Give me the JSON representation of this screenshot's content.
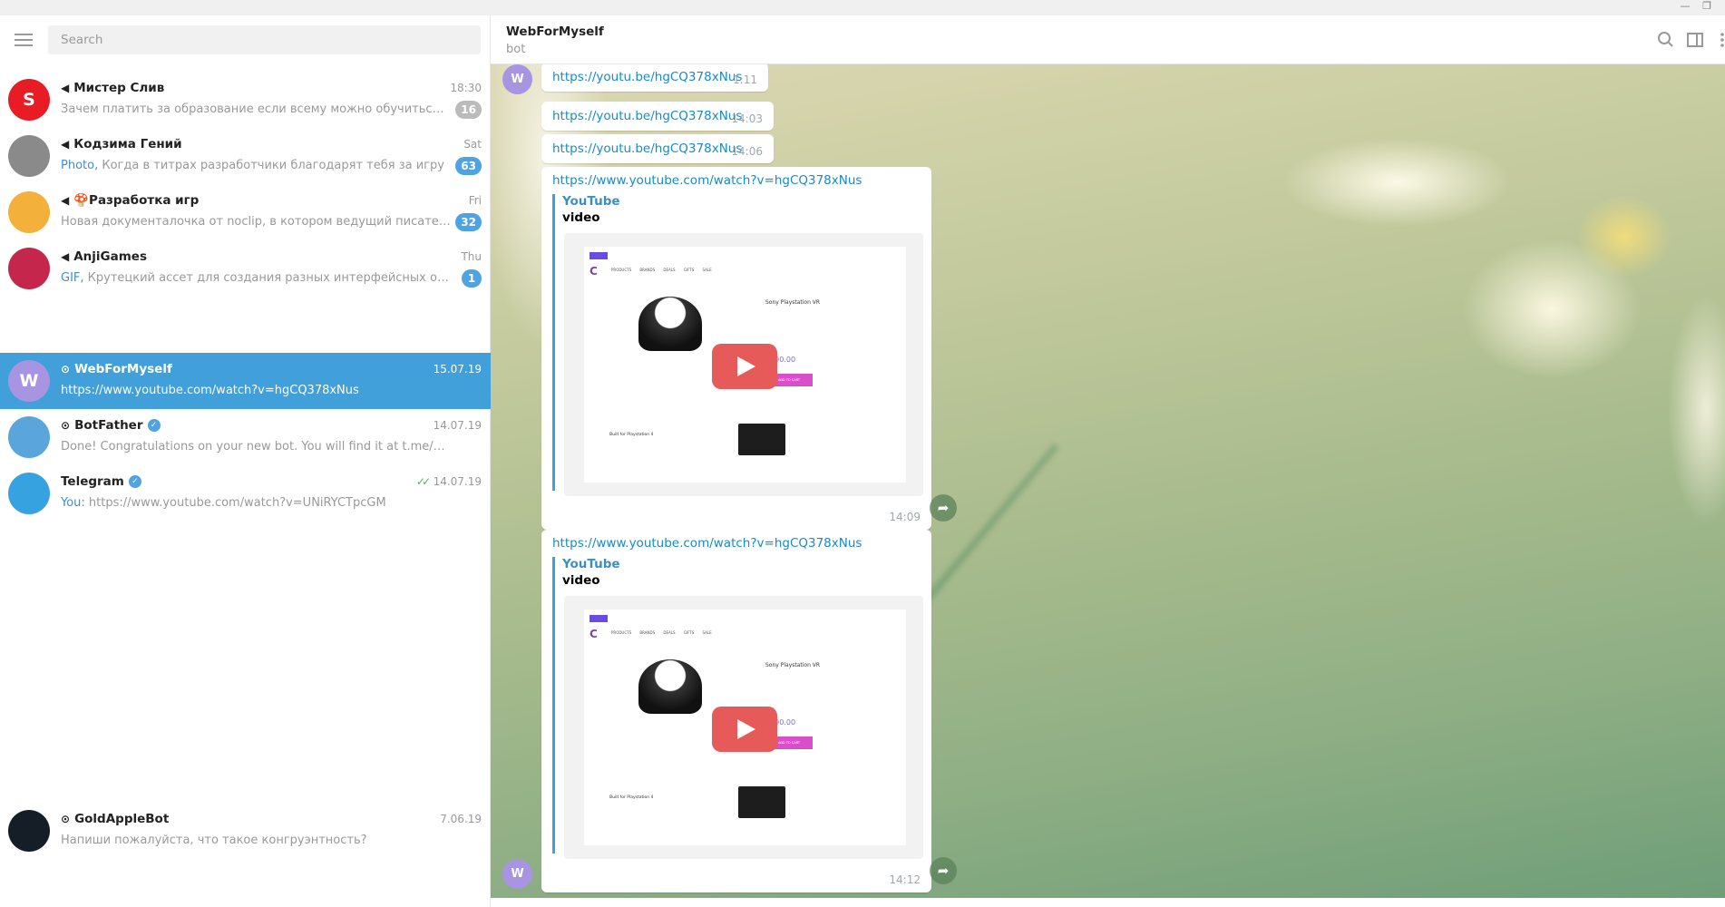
{
  "window": {
    "minimize": "—",
    "restore": "❐"
  },
  "sidebar": {
    "search_placeholder": "Search",
    "chats": [
      {
        "name": "Мистер Слив",
        "type": "channel",
        "date": "18:30",
        "preview_prefix": "",
        "preview": "Зачем платить за образование если всему можно обучиться беспл...",
        "badge": "16",
        "badge_muted": true,
        "avatar_color": "#e81c24",
        "avatar_text": "S"
      },
      {
        "name": "Кодзима Гений",
        "type": "channel",
        "date": "Sat",
        "preview_prefix": "Photo, ",
        "preview": "Когда в титрах разработчики благодарят тебя за игру",
        "badge": "63",
        "avatar_color": "#8a8a8a",
        "avatar_text": ""
      },
      {
        "name": "🍄Разработка игр",
        "type": "channel",
        "date": "Fri",
        "preview_prefix": "",
        "preview": "Новая документалочка от noclip, в котором ведущий писатель студ...",
        "badge": "32",
        "avatar_color": "#f3b13c",
        "avatar_text": ""
      },
      {
        "name": "AnjiGames",
        "type": "channel",
        "date": "Thu",
        "preview_prefix": "GIF, ",
        "preview": "Крутецкий ассет для создания разных интерфейсных округлосте...",
        "badge": "1",
        "avatar_color": "#c4264c",
        "avatar_text": ""
      },
      {
        "name": "WebForMyself",
        "type": "bot",
        "date": "15.07.19",
        "preview_prefix": "",
        "preview": "https://www.youtube.com/watch?v=hgCQ378xNus",
        "active": true,
        "avatar_color": "#a795e2",
        "avatar_text": "W"
      },
      {
        "name": "BotFather",
        "type": "bot",
        "verified": true,
        "date": "14.07.19",
        "preview_prefix": "",
        "preview": "Done! Congratulations on your new bot. You will find it at t.me/epiclegend_b...",
        "avatar_color": "#5aa5dc",
        "avatar_text": ""
      },
      {
        "name": "Telegram",
        "type": "user",
        "verified": true,
        "date": "14.07.19",
        "read": true,
        "preview_prefix": "You: ",
        "preview": "https://www.youtube.com/watch?v=UNiRYCTpcGM",
        "avatar_color": "#36a3e0",
        "avatar_text": ""
      },
      {
        "name": "GoldAppleBot",
        "type": "bot",
        "date": "7.06.19",
        "preview_prefix": "",
        "preview": "Напиши пожалуйста, что такое конгруэнтность?",
        "avatar_color": "#151d26",
        "avatar_text": ""
      }
    ]
  },
  "header": {
    "title": "WebForMyself",
    "subtitle": "bot"
  },
  "messages": [
    {
      "link": "https://youtu.be/hgCQ378xNus",
      "time": "1:11"
    },
    {
      "link": "https://youtu.be/hgCQ378xNus",
      "time": "14:03"
    },
    {
      "link": "https://youtu.be/hgCQ378xNus",
      "time": "14:06"
    },
    {
      "link": "https://www.youtube.com/watch?v=hgCQ378xNus",
      "time": "14:09",
      "site": "YouTube",
      "title": "video",
      "thumb": {
        "product": "Sony Playstation VR",
        "price": "$390.00",
        "button": "ADD TO CART",
        "section": "Built for Playstation 4",
        "nav": [
          "PRODUCTS",
          "BRANDS",
          "DEALS",
          "GIFTS",
          "SALE"
        ]
      }
    },
    {
      "link": "https://www.youtube.com/watch?v=hgCQ378xNus",
      "time": "14:12",
      "site": "YouTube",
      "title": "video",
      "thumb": {
        "product": "Sony Playstation VR",
        "price": "$390.00",
        "button": "ADD TO CART",
        "section": "Built for Playstation 4",
        "nav": [
          "PRODUCTS",
          "BRANDS",
          "DEALS",
          "GIFTS",
          "SALE"
        ]
      }
    }
  ],
  "avatar_letter": "W",
  "colors": {
    "accent": "#419fd9",
    "link": "#168acd",
    "badge": "#4ea3e0"
  }
}
